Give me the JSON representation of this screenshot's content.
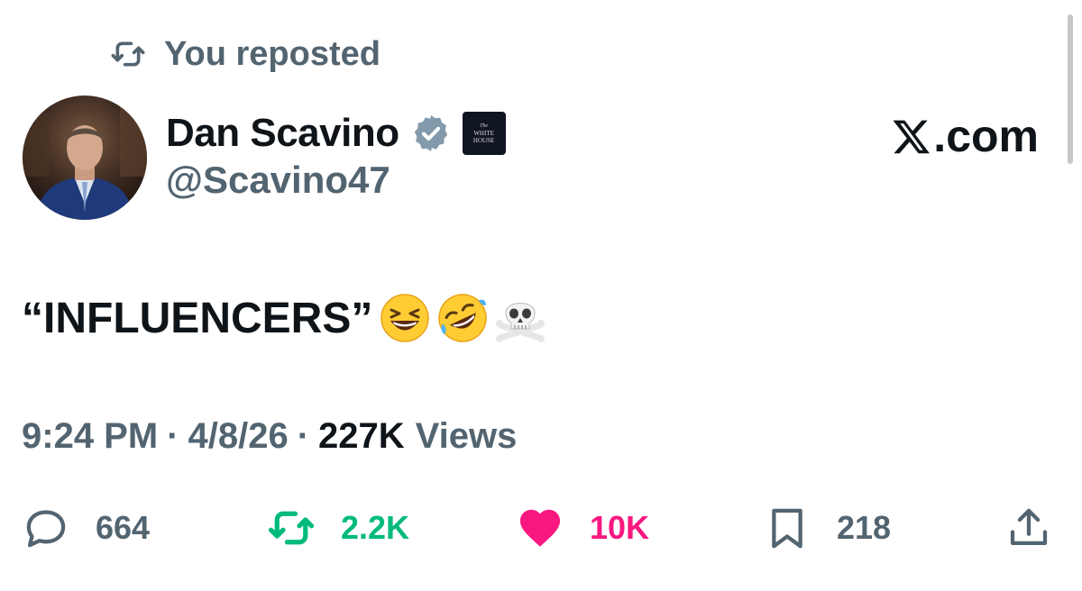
{
  "repost_banner": {
    "label": "You reposted",
    "icon": "repost-icon"
  },
  "author": {
    "display_name": "Dan Scavino",
    "handle": "@Scavino47",
    "verified_icon": "verified-badge-icon",
    "affiliation_badge": {
      "line1": "The",
      "line2": "WHITE",
      "line3": "HOUSE"
    }
  },
  "brand": {
    "label": ".com",
    "icon": "x-logo-icon"
  },
  "tweet": {
    "text": "“INFLUENCERS”",
    "emojis": [
      "grinning-squinting-face",
      "rolling-on-floor-laughing",
      "skull-and-crossbones"
    ]
  },
  "meta": {
    "time": "9:24 PM",
    "separator": "·",
    "date": "4/8/26",
    "views_count": "227K",
    "views_label": "Views"
  },
  "actions": {
    "reply_count": "664",
    "repost_count": "2.2K",
    "like_count": "10K",
    "bookmark_count": "218"
  },
  "colors": {
    "text_primary": "#0f1419",
    "text_secondary": "#536471",
    "repost_active": "#00ba7c",
    "like_active": "#f91880"
  }
}
